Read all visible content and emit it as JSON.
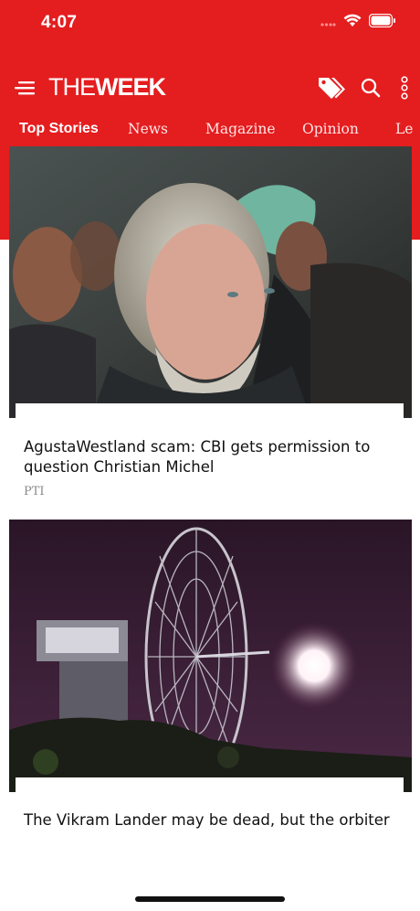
{
  "status_bar": {
    "time": "4:07"
  },
  "header": {
    "logo_prefix": "THE",
    "logo_suffix": "WEEK",
    "icons": [
      "menu-icon",
      "tag-icon",
      "search-icon",
      "more-vertical-icon"
    ]
  },
  "tabs": [
    {
      "label": "Top Stories",
      "active": true
    },
    {
      "label": "News"
    },
    {
      "label": "Magazine"
    },
    {
      "label": "Opinion"
    },
    {
      "label": "Le"
    }
  ],
  "articles": [
    {
      "headline": "AgustaWestland scam: CBI gets permission to question Christian Michel",
      "source": "PTI",
      "image": "photo of Christian Michel with police officers"
    },
    {
      "headline": "The Vikram Lander may be dead, but the orbiter",
      "image": "satellite dish antenna at night with moon"
    }
  ],
  "colors": {
    "brand_red": "#e41d1f"
  }
}
